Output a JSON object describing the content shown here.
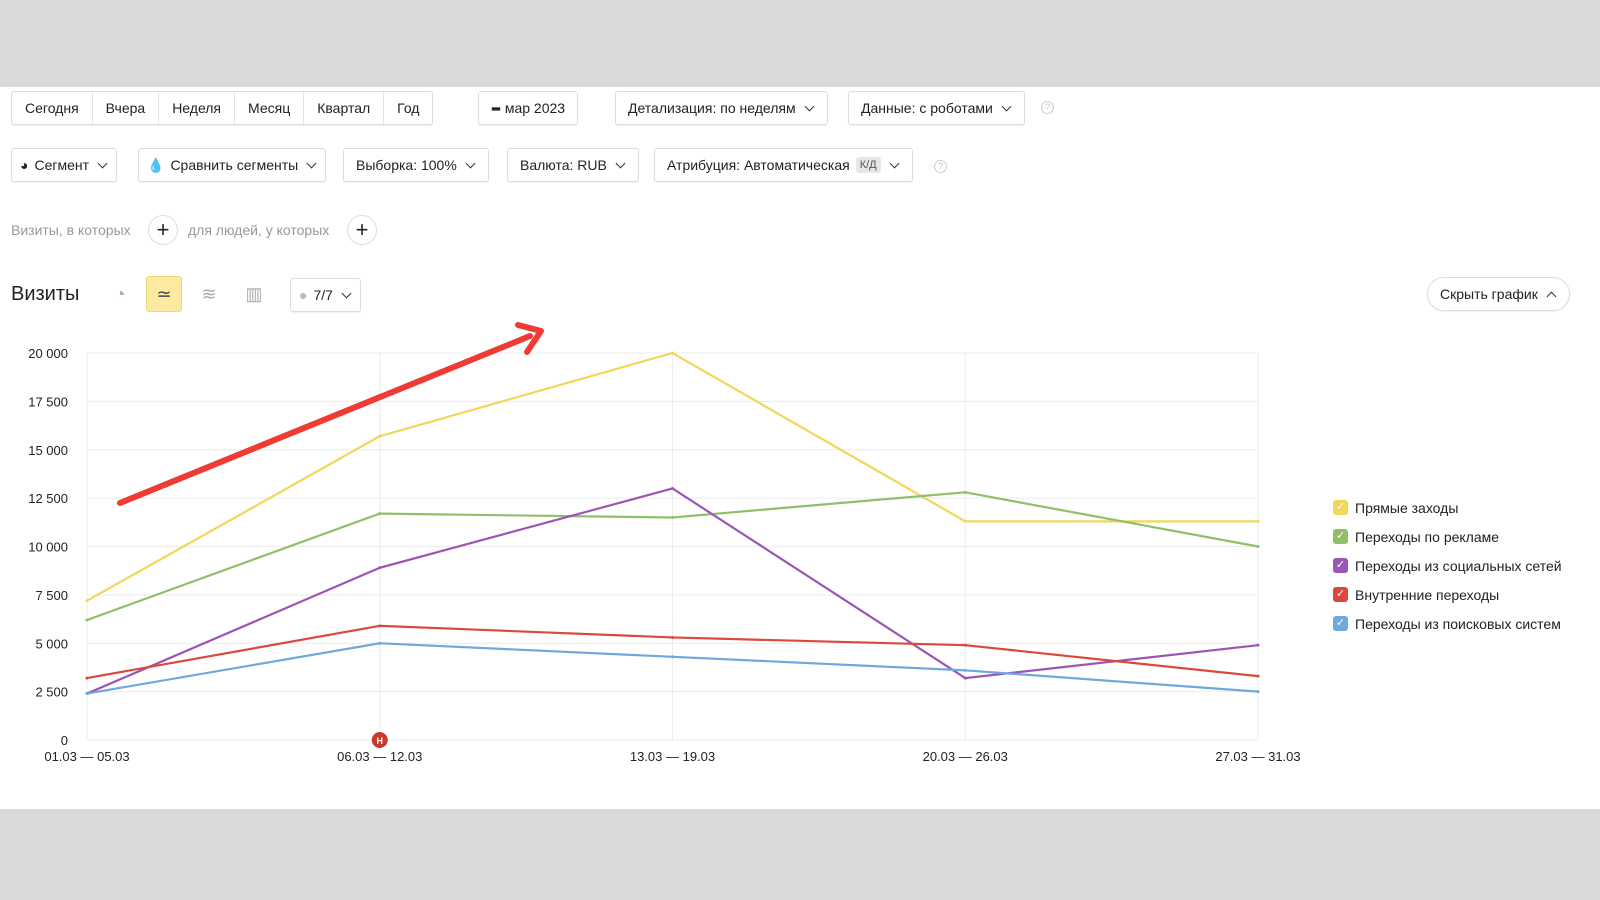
{
  "toolbar": {
    "periods": [
      "Сегодня",
      "Вчера",
      "Неделя",
      "Месяц",
      "Квартал",
      "Год"
    ],
    "date": "мар 2023",
    "detail": "Детализация: по неделям",
    "data_mode": "Данные: с роботами",
    "segment": "Сегмент",
    "compare": "Сравнить сегменты",
    "sample": "Выборка: 100%",
    "currency": "Валюта: RUB",
    "attribution": "Атрибуция: Автоматическая",
    "attribution_badge": "К/Д",
    "help": "?"
  },
  "filters": {
    "visits_label": "Визиты, в которых",
    "people_label": "для людей, у которых",
    "plus": "+"
  },
  "chart_header": {
    "title": "Визиты",
    "notes": "7/7",
    "hide": "Скрыть график"
  },
  "marker": "Н",
  "chart_data": {
    "type": "line",
    "ylabel": "Визиты",
    "ylim": [
      0,
      20000
    ],
    "yticks": [
      "0",
      "2 500",
      "5 000",
      "7 500",
      "10 000",
      "12 500",
      "15 000",
      "17 500",
      "20 000"
    ],
    "ytick_values": [
      0,
      2500,
      5000,
      7500,
      10000,
      12500,
      15000,
      17500,
      20000
    ],
    "categories": [
      "01.03 — 05.03",
      "06.03 — 12.03",
      "13.03 — 19.03",
      "20.03 — 26.03",
      "27.03 — 31.03"
    ],
    "series": [
      {
        "name": "Прямые заходы",
        "color": "#f0d75a",
        "values": [
          7200,
          15700,
          20000,
          11300,
          11300
        ]
      },
      {
        "name": "Переходы по рекламе",
        "color": "#8fc068",
        "values": [
          6200,
          11700,
          11500,
          12800,
          10000
        ]
      },
      {
        "name": "Переходы из социальных сетей",
        "color": "#9b55b5",
        "values": [
          2400,
          8900,
          13000,
          3200,
          4900
        ]
      },
      {
        "name": "Внутренние переходы",
        "color": "#d9493c",
        "values": [
          3200,
          5900,
          5300,
          4900,
          3300
        ]
      },
      {
        "name": "Переходы из поисковых систем",
        "color": "#6fa8dc",
        "values": [
          2400,
          5000,
          4300,
          3600,
          2500
        ]
      }
    ],
    "legend_position": "right",
    "grid": true
  }
}
